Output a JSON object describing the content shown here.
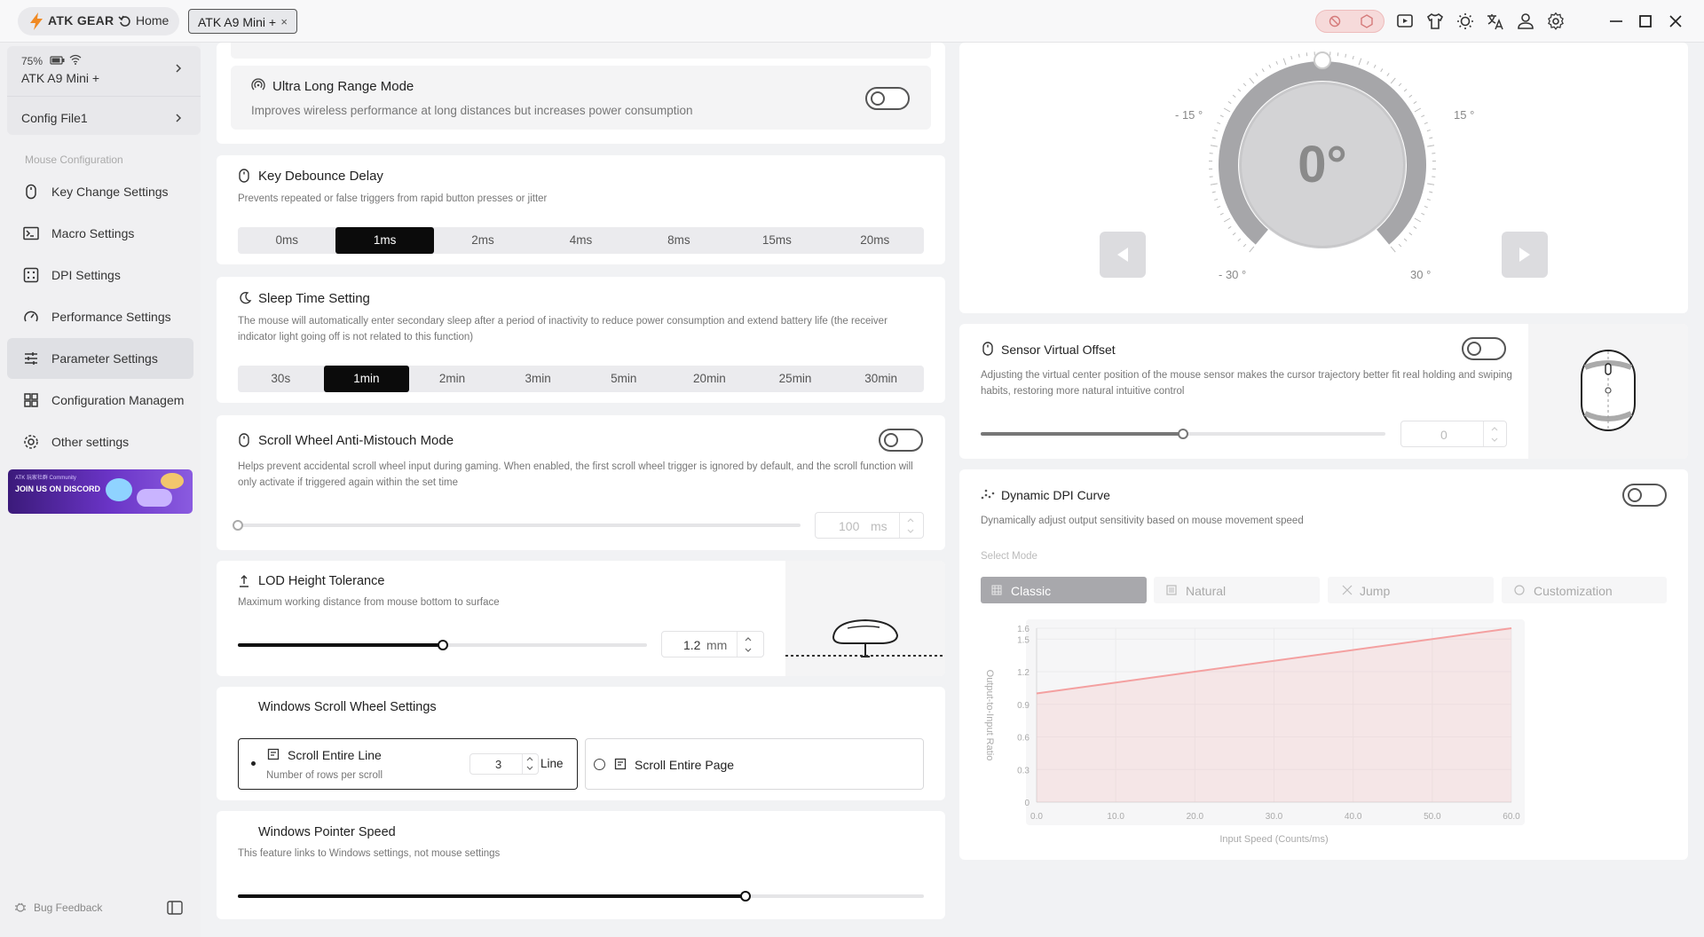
{
  "titlebar": {
    "brand": "ATK GEAR",
    "home": "Home",
    "device_tab": "ATK A9 Mini +",
    "close_tab": "×"
  },
  "sidebar": {
    "battery": "75%",
    "device_name": "ATK A9 Mini +",
    "config": "Config File1",
    "section": "Mouse Configuration",
    "items": [
      {
        "label": "Key Change Settings",
        "icon": "mouse-icon"
      },
      {
        "label": "Macro Settings",
        "icon": "terminal-icon"
      },
      {
        "label": "DPI Settings",
        "icon": "dpi-icon"
      },
      {
        "label": "Performance Settings",
        "icon": "gauge-icon"
      },
      {
        "label": "Parameter Settings",
        "icon": "sliders-icon"
      },
      {
        "label": "Configuration Managem",
        "icon": "grid-icon"
      },
      {
        "label": "Other settings",
        "icon": "gear-icon"
      }
    ],
    "banner_top": "ATK 玩家社群 Community",
    "banner_text": "JOIN US ON DISCORD",
    "bug_feedback": "Bug Feedback"
  },
  "ultra": {
    "title": "Ultra Long Range Mode",
    "desc": "Improves wireless performance at long distances but increases power consumption",
    "enabled": false
  },
  "debounce": {
    "title": "Key Debounce Delay",
    "desc": "Prevents repeated or false triggers from rapid button presses or jitter",
    "options": [
      "0ms",
      "1ms",
      "2ms",
      "4ms",
      "8ms",
      "15ms",
      "20ms"
    ],
    "selected": "1ms"
  },
  "sleep": {
    "title": "Sleep Time Setting",
    "desc": "The mouse will automatically enter secondary sleep after a period of inactivity to reduce power consumption and extend battery life (the receiver indicator light going off is not related to this function)",
    "options": [
      "30s",
      "1min",
      "2min",
      "3min",
      "5min",
      "20min",
      "25min",
      "30min"
    ],
    "selected": "1min"
  },
  "antimistouch": {
    "title": "Scroll Wheel Anti-Mistouch Mode",
    "desc": "Helps prevent accidental scroll wheel input during gaming. When enabled, the first scroll wheel trigger is ignored by default, and the scroll function will only activate if triggered again within the set time",
    "value": "100",
    "unit": "ms",
    "enabled": false
  },
  "lod": {
    "title": "LOD Height Tolerance",
    "desc": "Maximum working distance from mouse bottom to surface",
    "value": "1.2",
    "unit": "mm",
    "fraction": 0.5
  },
  "scroll": {
    "title": "Windows Scroll Wheel Settings",
    "line_title": "Scroll Entire Line",
    "line_desc": "Number of rows per scroll",
    "line_value": "3",
    "line_unit": "Line",
    "page_title": "Scroll Entire Page",
    "selected": "line"
  },
  "pointer": {
    "title": "Windows Pointer Speed",
    "desc": "This feature links to Windows settings, not mouse settings",
    "fraction": 0.74
  },
  "angle": {
    "value": "0°",
    "labels": [
      "- 15 °",
      "15 °",
      "- 30 °",
      "30 °"
    ]
  },
  "offset": {
    "title": "Sensor Virtual Offset",
    "desc": "Adjusting the virtual center position of the mouse sensor makes the cursor trajectory better fit real holding and swiping habits, restoring more natural intuitive control",
    "value": "0",
    "enabled": false,
    "fraction": 0.5
  },
  "dpi_curve": {
    "title": "Dynamic DPI Curve",
    "desc": "Dynamically adjust output sensitivity based on mouse movement speed",
    "select_mode": "Select Mode",
    "modes": [
      "Classic",
      "Natural",
      "Jump",
      "Customization"
    ],
    "selected": "Classic",
    "enabled": false
  },
  "chart_data": {
    "type": "area",
    "x": [
      0,
      60
    ],
    "y": [
      1.0,
      1.6
    ],
    "xticks": [
      "0.0",
      "10.0",
      "20.0",
      "30.0",
      "40.0",
      "50.0",
      "60.0"
    ],
    "yticks": [
      "0",
      "0.3",
      "0.6",
      "0.9",
      "1.2",
      "1.5",
      "1.6"
    ],
    "xlabel": "Input Speed (Counts/ms)",
    "ylabel": "Output-to-Input Ratio",
    "xlim": [
      0,
      60
    ],
    "ylim": [
      0,
      1.6
    ],
    "color": "#f4a0a0"
  },
  "colors": {
    "accent": "#f08a24",
    "active_bg": "#0b0b0b",
    "chart": "#f4a0a0"
  }
}
